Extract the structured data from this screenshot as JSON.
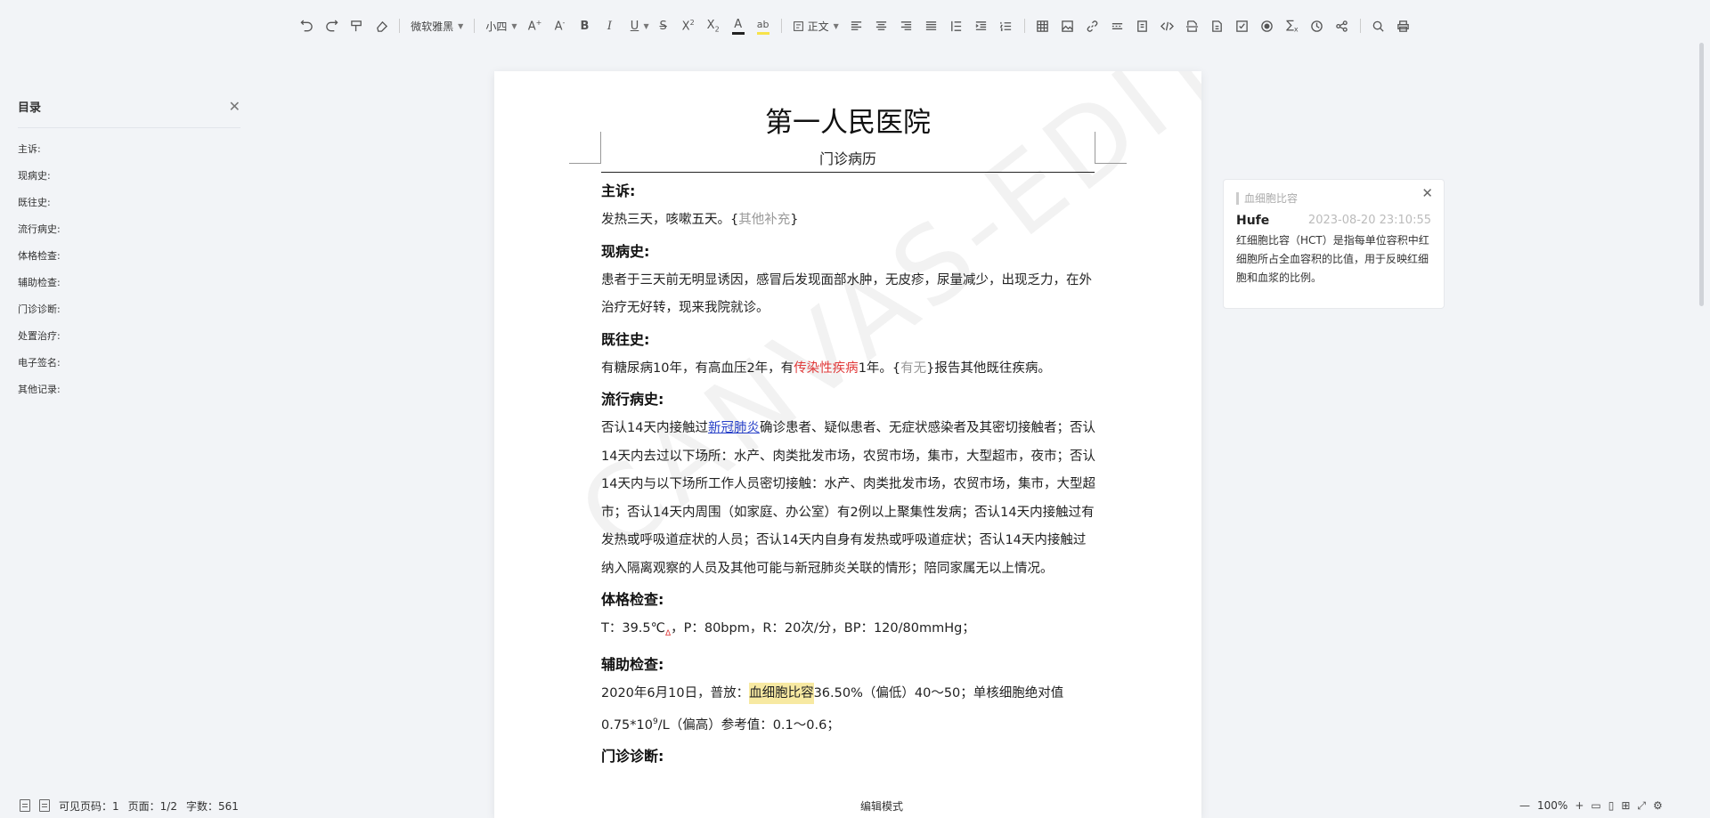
{
  "toolbar": {
    "font_family": "微软雅黑",
    "font_size": "小四",
    "paragraph_style": "正文",
    "font_color": "#222222",
    "highlight_color": "#f7e34a"
  },
  "catalog": {
    "title": "目录",
    "items": [
      "主诉:",
      "现病史:",
      "既往史:",
      "流行病史:",
      "体格检查:",
      "辅助检查:",
      "门诊诊断:",
      "处置治疗:",
      "电子签名:",
      "其他记录:"
    ]
  },
  "document": {
    "title": "第一人民医院",
    "subtitle": "门诊病历",
    "watermark": "CANVAS-EDITOR",
    "chief_complaint": {
      "heading": "主诉:",
      "text": "发热三天，咳嗽五天。{",
      "placeholder": "其他补充",
      "close": "}"
    },
    "present_illness": {
      "heading": "现病史:",
      "text": "患者于三天前无明显诱因，感冒后发现面部水肿，无皮疹，尿量减少，出现乏力，在外治疗无好转，现来我院就诊。"
    },
    "past_history": {
      "heading": "既往史:",
      "text_1": "有糖尿病10年，有高血压2年，有",
      "red_text": "传染性疾病",
      "text_2": "1年。{",
      "placeholder": "有无",
      "text_3": "}报告其他既往疾病。"
    },
    "epidemic_history": {
      "heading": "流行病史:",
      "text_1": "否认14天内接触过",
      "link": "新冠肺炎",
      "text_2": "确诊患者、疑似患者、无症状感染者及其密切接触者；否认14天内去过以下场所：水产、肉类批发市场，农贸市场，集市，大型超市，夜市；否认14天内与以下场所工作人员密切接触：水产、肉类批发市场，农贸市场，集市，大型超市；否认14天内周围（如家庭、办公室）有2例以上聚集性发病；否认14天内接触过有发热或呼吸道症状的人员；否认14天内自身有发热或呼吸道症状；否认14天内接触过纳入隔离观察的人员及其他可能与新冠肺炎关联的情形；陪同家属无以上情况。"
    },
    "physical_exam": {
      "heading": "体格检查:",
      "text_1": "T：39.5℃",
      "sub": "Δ",
      "text_2": "，P：80bpm，R：20次/分，BP：120/80mmHg；"
    },
    "aux_exam": {
      "heading": "辅助检查:",
      "text_1": "2020年6月10日，普放：",
      "highlight": "血细胞比容",
      "text_2": "36.50%（偏低）40～50；单核细胞绝对值0.75*10",
      "sup": "9",
      "text_3": "/L（偏高）参考值：0.1～0.6；"
    },
    "diagnosis": {
      "heading": "门诊诊断:"
    }
  },
  "comment": {
    "reference": "血细胞比容",
    "user": "Hufe",
    "time": "2023-08-20 23:10:55",
    "text": "红细胞比容（HCT）是指每单位容积中红细胞所占全血容积的比值，用于反映红细胞和血浆的比例。"
  },
  "statusbar": {
    "visible_pages": "可见页码：1",
    "page": "页面：1/2",
    "word_count": "字数：561",
    "mode": "编辑模式",
    "zoom": "100%"
  }
}
